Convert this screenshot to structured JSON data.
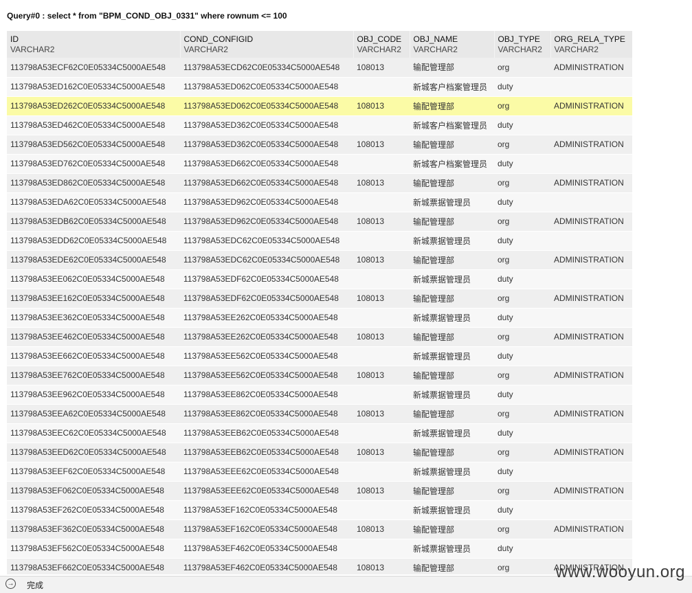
{
  "query": {
    "title": "Query#0 : select * from \"BPM_COND_OBJ_0331\" where rownum <= 100"
  },
  "table": {
    "columns": [
      {
        "name": "ID",
        "type": "VARCHAR2"
      },
      {
        "name": "COND_CONFIGID",
        "type": "VARCHAR2"
      },
      {
        "name": "OBJ_CODE",
        "type": "VARCHAR2"
      },
      {
        "name": "OBJ_NAME",
        "type": "VARCHAR2"
      },
      {
        "name": "OBJ_TYPE",
        "type": "VARCHAR2"
      },
      {
        "name": "ORG_RELA_TYPE",
        "type": "VARCHAR2"
      }
    ],
    "highlighted_row": 2,
    "rows": [
      [
        "113798A53ECF62C0E05334C5000AE548",
        "113798A53ECD62C0E05334C5000AE548",
        "108013",
        "输配管理部",
        "org",
        "ADMINISTRATION"
      ],
      [
        "113798A53ED162C0E05334C5000AE548",
        "113798A53ED062C0E05334C5000AE548",
        "",
        "新城客户档案管理员",
        "duty",
        ""
      ],
      [
        "113798A53ED262C0E05334C5000AE548",
        "113798A53ED062C0E05334C5000AE548",
        "108013",
        "输配管理部",
        "org",
        "ADMINISTRATION"
      ],
      [
        "113798A53ED462C0E05334C5000AE548",
        "113798A53ED362C0E05334C5000AE548",
        "",
        "新城客户档案管理员",
        "duty",
        ""
      ],
      [
        "113798A53ED562C0E05334C5000AE548",
        "113798A53ED362C0E05334C5000AE548",
        "108013",
        "输配管理部",
        "org",
        "ADMINISTRATION"
      ],
      [
        "113798A53ED762C0E05334C5000AE548",
        "113798A53ED662C0E05334C5000AE548",
        "",
        "新城客户档案管理员",
        "duty",
        ""
      ],
      [
        "113798A53ED862C0E05334C5000AE548",
        "113798A53ED662C0E05334C5000AE548",
        "108013",
        "输配管理部",
        "org",
        "ADMINISTRATION"
      ],
      [
        "113798A53EDA62C0E05334C5000AE548",
        "113798A53ED962C0E05334C5000AE548",
        "",
        "新城票据管理员",
        "duty",
        ""
      ],
      [
        "113798A53EDB62C0E05334C5000AE548",
        "113798A53ED962C0E05334C5000AE548",
        "108013",
        "输配管理部",
        "org",
        "ADMINISTRATION"
      ],
      [
        "113798A53EDD62C0E05334C5000AE548",
        "113798A53EDC62C0E05334C5000AE548",
        "",
        "新城票据管理员",
        "duty",
        ""
      ],
      [
        "113798A53EDE62C0E05334C5000AE548",
        "113798A53EDC62C0E05334C5000AE548",
        "108013",
        "输配管理部",
        "org",
        "ADMINISTRATION"
      ],
      [
        "113798A53EE062C0E05334C5000AE548",
        "113798A53EDF62C0E05334C5000AE548",
        "",
        "新城票据管理员",
        "duty",
        ""
      ],
      [
        "113798A53EE162C0E05334C5000AE548",
        "113798A53EDF62C0E05334C5000AE548",
        "108013",
        "输配管理部",
        "org",
        "ADMINISTRATION"
      ],
      [
        "113798A53EE362C0E05334C5000AE548",
        "113798A53EE262C0E05334C5000AE548",
        "",
        "新城票据管理员",
        "duty",
        ""
      ],
      [
        "113798A53EE462C0E05334C5000AE548",
        "113798A53EE262C0E05334C5000AE548",
        "108013",
        "输配管理部",
        "org",
        "ADMINISTRATION"
      ],
      [
        "113798A53EE662C0E05334C5000AE548",
        "113798A53EE562C0E05334C5000AE548",
        "",
        "新城票据管理员",
        "duty",
        ""
      ],
      [
        "113798A53EE762C0E05334C5000AE548",
        "113798A53EE562C0E05334C5000AE548",
        "108013",
        "输配管理部",
        "org",
        "ADMINISTRATION"
      ],
      [
        "113798A53EE962C0E05334C5000AE548",
        "113798A53EE862C0E05334C5000AE548",
        "",
        "新城票据管理员",
        "duty",
        ""
      ],
      [
        "113798A53EEA62C0E05334C5000AE548",
        "113798A53EE862C0E05334C5000AE548",
        "108013",
        "输配管理部",
        "org",
        "ADMINISTRATION"
      ],
      [
        "113798A53EEC62C0E05334C5000AE548",
        "113798A53EEB62C0E05334C5000AE548",
        "",
        "新城票据管理员",
        "duty",
        ""
      ],
      [
        "113798A53EED62C0E05334C5000AE548",
        "113798A53EEB62C0E05334C5000AE548",
        "108013",
        "输配管理部",
        "org",
        "ADMINISTRATION"
      ],
      [
        "113798A53EEF62C0E05334C5000AE548",
        "113798A53EEE62C0E05334C5000AE548",
        "",
        "新城票据管理员",
        "duty",
        ""
      ],
      [
        "113798A53EF062C0E05334C5000AE548",
        "113798A53EEE62C0E05334C5000AE548",
        "108013",
        "输配管理部",
        "org",
        "ADMINISTRATION"
      ],
      [
        "113798A53EF262C0E05334C5000AE548",
        "113798A53EF162C0E05334C5000AE548",
        "",
        "新城票据管理员",
        "duty",
        ""
      ],
      [
        "113798A53EF362C0E05334C5000AE548",
        "113798A53EF162C0E05334C5000AE548",
        "108013",
        "输配管理部",
        "org",
        "ADMINISTRATION"
      ],
      [
        "113798A53EF562C0E05334C5000AE548",
        "113798A53EF462C0E05334C5000AE548",
        "",
        "新城票据管理员",
        "duty",
        ""
      ],
      [
        "113798A53EF662C0E05334C5000AE548",
        "113798A53EF462C0E05334C5000AE548",
        "108013",
        "输配管理部",
        "org",
        "ADMINISTRATION"
      ]
    ]
  },
  "status_bar": {
    "icon": "arrow-right-circle-icon",
    "text": "完成"
  },
  "watermark": {
    "text": "www.wooyun.org"
  }
}
